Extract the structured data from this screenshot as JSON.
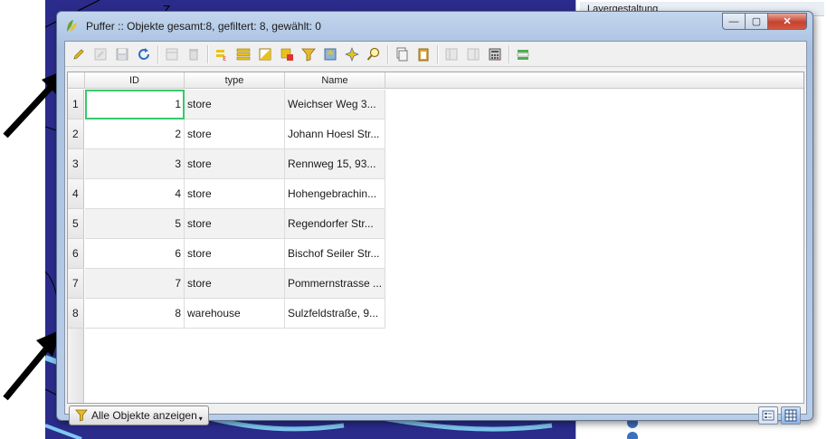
{
  "window": {
    "title": "Puffer :: Objekte gesamt:8, gefiltert: 8, gewählt: 0",
    "controls": {
      "minimize": "—",
      "maximize": "▢",
      "close": "✕"
    }
  },
  "toolbar": {
    "buttons": [
      {
        "name": "toggle-editing-icon",
        "enabled": true
      },
      {
        "name": "toggle-multi-edit-icon",
        "enabled": false
      },
      {
        "name": "save-edits-icon",
        "enabled": false
      },
      {
        "name": "reload-table-icon",
        "enabled": true
      },
      {
        "name": "add-feature-icon",
        "enabled": false
      },
      {
        "name": "delete-selected-icon",
        "enabled": false
      },
      {
        "name": "select-by-expression-icon",
        "enabled": true
      },
      {
        "name": "select-all-icon",
        "enabled": true
      },
      {
        "name": "invert-selection-icon",
        "enabled": true
      },
      {
        "name": "deselect-all-icon",
        "enabled": true
      },
      {
        "name": "filter-select-icon",
        "enabled": true
      },
      {
        "name": "move-selection-to-top-icon",
        "enabled": true
      },
      {
        "name": "pan-map-to-selected-icon",
        "enabled": true
      },
      {
        "name": "zoom-map-to-selected-icon",
        "enabled": true
      },
      {
        "name": "copy-selected-rows-icon",
        "enabled": true
      },
      {
        "name": "paste-features-icon",
        "enabled": true
      },
      {
        "name": "new-field-icon",
        "enabled": false
      },
      {
        "name": "delete-field-icon",
        "enabled": false
      },
      {
        "name": "field-calculator-icon",
        "enabled": true
      },
      {
        "name": "conditional-formatting-icon",
        "enabled": true
      }
    ]
  },
  "table": {
    "columns": [
      "ID",
      "type",
      "Name"
    ],
    "rows": [
      {
        "num": "1",
        "id": "1",
        "type": "store",
        "name": "Weichser Weg 3..."
      },
      {
        "num": "2",
        "id": "2",
        "type": "store",
        "name": "Johann Hoesl Str..."
      },
      {
        "num": "3",
        "id": "3",
        "type": "store",
        "name": "Rennweg 15, 93..."
      },
      {
        "num": "4",
        "id": "4",
        "type": "store",
        "name": "Hohengebrachin..."
      },
      {
        "num": "5",
        "id": "5",
        "type": "store",
        "name": "Regendorfer Str..."
      },
      {
        "num": "6",
        "id": "6",
        "type": "store",
        "name": "Bischof Seiler Str..."
      },
      {
        "num": "7",
        "id": "7",
        "type": "store",
        "name": "Pommernstrasse ..."
      },
      {
        "num": "8",
        "id": "8",
        "type": "warehouse",
        "name": "Sulzfeldstraße, 9..."
      }
    ]
  },
  "footer": {
    "show_all_label": "Alle Objekte anzeigen"
  },
  "side_panel": {
    "header": "Layergestaltung"
  },
  "colors": {
    "map_background": "#2b2b8c",
    "focus_outline": "#35c96a",
    "close_button": "#c5432f"
  }
}
